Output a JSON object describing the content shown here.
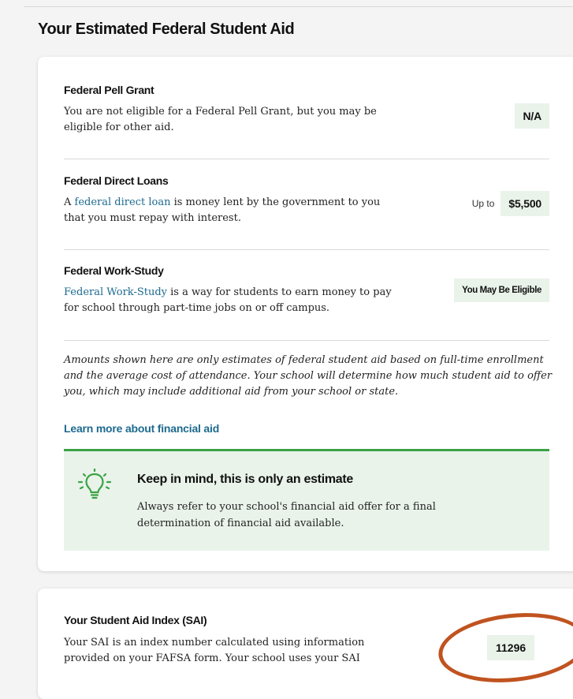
{
  "section_title": "Your Estimated Federal Student Aid",
  "aid_items": [
    {
      "title": "Federal Pell Grant",
      "desc_before": "You are not eligible for a Federal Pell Grant, but you may be eligible for other aid.",
      "prefix": "",
      "amount": "N/A"
    },
    {
      "title": "Federal Direct Loans",
      "desc_before": "A ",
      "link": "federal direct loan",
      "desc_after": " is money lent by the government to you that you must repay with interest.",
      "prefix": "Up to",
      "amount": "$5,500"
    },
    {
      "title": "Federal Work-Study",
      "link": "Federal Work-Study",
      "desc_after": " is a way for students to earn money to pay for school through part-time jobs on or off campus.",
      "prefix": "",
      "amount": "You May Be Eligible"
    }
  ],
  "disclaimer": "Amounts shown here are only estimates of federal student aid based on full-time enrollment and the average cost of attendance. Your school will determine how much student aid to offer you, which may include additional aid from your school or state.",
  "learn_more": "Learn more about financial aid",
  "callout": {
    "icon": "lightbulb-icon",
    "title": "Keep in mind, this is only an estimate",
    "text": "Always refer to your school's financial aid offer for a final determination of financial aid available."
  },
  "sai": {
    "title": "Your Student Aid Index (SAI)",
    "desc": "Your SAI is an index number calculated using information provided on your FAFSA form. Your school uses your SAI",
    "value": "11296"
  },
  "colors": {
    "link": "#1d6a8f",
    "accent_green": "#3ba245",
    "highlight_bg": "#e9f3ea",
    "annotation_circle": "#c0531f"
  }
}
